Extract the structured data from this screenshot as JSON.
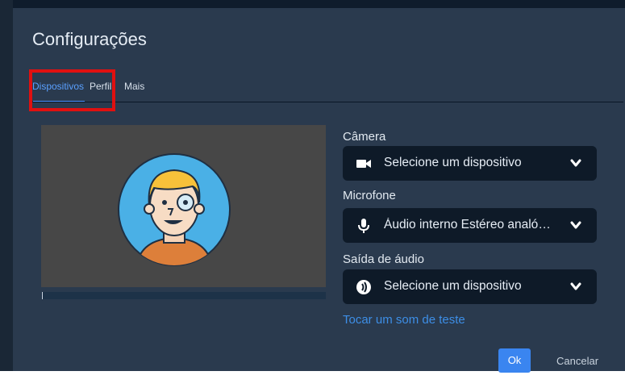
{
  "dialog": {
    "title": "Configurações",
    "tabs": [
      {
        "label": "Dispositivos",
        "active": true
      },
      {
        "label": "Perfil",
        "active": false
      },
      {
        "label": "Mais",
        "active": false
      }
    ]
  },
  "devices": {
    "camera": {
      "label": "Câmera",
      "value": "Selecione um dispositivo",
      "icon": "video-camera-icon"
    },
    "microphone": {
      "label": "Microfone",
      "value": "Áudio interno Estéreo analógico",
      "icon": "microphone-icon"
    },
    "audio_output": {
      "label": "Saída de áudio",
      "value": "Selecione um dispositivo",
      "icon": "speaker-icon"
    },
    "test_sound_link": "Tocar um som de teste",
    "mic_level": 0.0
  },
  "footer": {
    "ok_label": "Ok",
    "cancel_label": "Cancelar"
  },
  "colors": {
    "accent": "#3a85f0",
    "highlight": "#e01010",
    "dialog_bg": "#2a3a4e",
    "select_bg": "#0e1a28"
  }
}
